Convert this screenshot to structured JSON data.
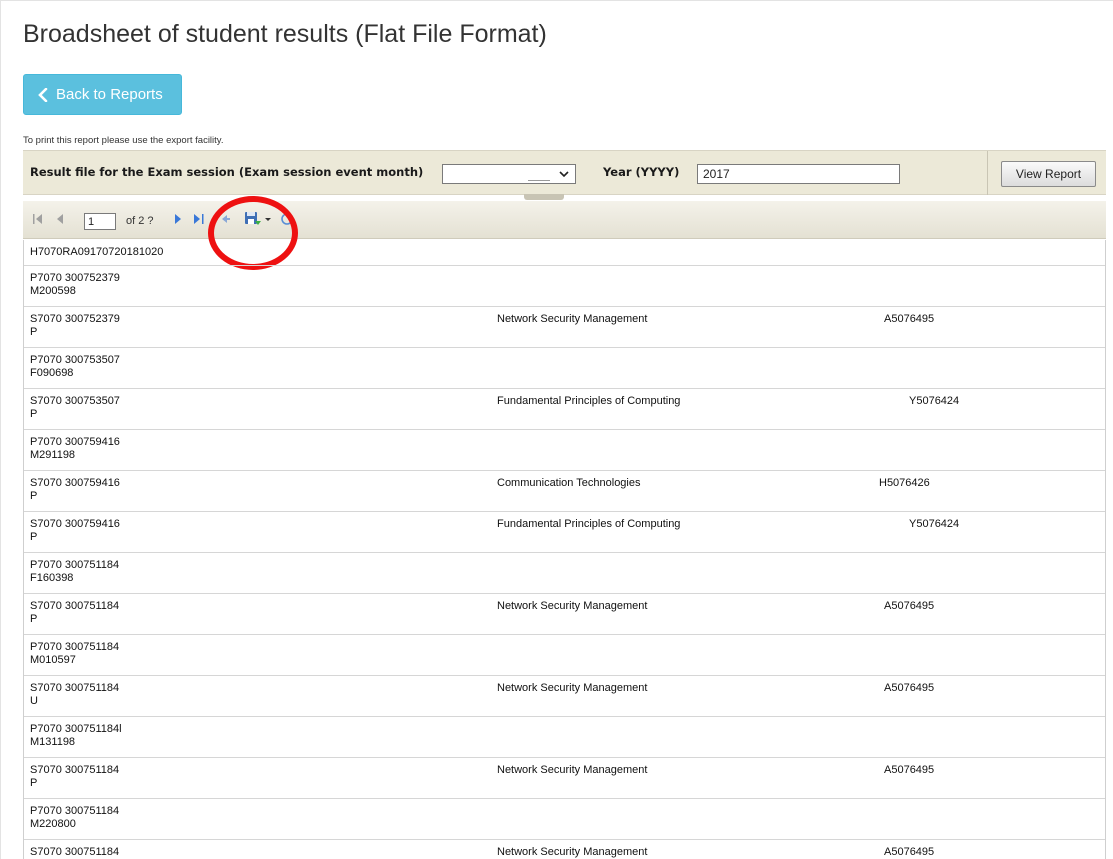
{
  "page": {
    "title": "Broadsheet of student results (Flat File Format)",
    "back_button": "Back to Reports",
    "print_note": "To print this report please use the export facility."
  },
  "params": {
    "month_label": "Result file for the Exam session (Exam session event month)",
    "month_value": "",
    "year_label": "Year (YYYY)",
    "year_value": "2017",
    "view_report": "View Report"
  },
  "toolbar": {
    "current_page": "1",
    "page_of": "of 2 ?",
    "icons": [
      "first-page-icon",
      "previous-page-icon",
      "next-page-icon",
      "last-page-icon",
      "back-icon",
      "save-export-icon",
      "refresh-icon"
    ]
  },
  "colors": {
    "accent": "#5bc0de",
    "param_bar": "#ece9d8",
    "highlight": "#ee1111"
  },
  "rows": [
    {
      "line1": "H7070RA09170720181020",
      "line2": "",
      "subject": "",
      "code": ""
    },
    {
      "line1": "P7070  300752379",
      "line2": "M200598",
      "subject": "",
      "code": ""
    },
    {
      "line1": "S7070  300752379",
      "line2": "P",
      "subject": "Network Security Management",
      "code": "A5076495"
    },
    {
      "line1": "P7070  300753507",
      "line2": "F090698",
      "subject": "",
      "code": ""
    },
    {
      "line1": "S7070  300753507",
      "line2": "P",
      "subject": "Fundamental Principles of Computing",
      "code": "Y5076424"
    },
    {
      "line1": "P7070  300759416",
      "line2": "M291198",
      "subject": "",
      "code": ""
    },
    {
      "line1": "S7070  300759416",
      "line2": "P",
      "subject": "Communication Technologies",
      "code": "H5076426"
    },
    {
      "line1": "S7070  300759416",
      "line2": "P",
      "subject": "Fundamental Principles of Computing",
      "code": "Y5076424"
    },
    {
      "line1": "P7070  300751184",
      "line2": "F160398",
      "subject": "",
      "code": ""
    },
    {
      "line1": "S7070  300751184",
      "line2": "P",
      "subject": "Network Security Management",
      "code": "A5076495"
    },
    {
      "line1": "P7070  300751184",
      "line2": "M010597",
      "subject": "",
      "code": ""
    },
    {
      "line1": "S7070  300751184",
      "line2": "U",
      "subject": "Network Security Management",
      "code": "A5076495"
    },
    {
      "line1": "P7070  300751184l",
      "line2": "M131198",
      "subject": "",
      "code": ""
    },
    {
      "line1": "S7070  300751184",
      "line2": "P",
      "subject": "Network Security Management",
      "code": "A5076495"
    },
    {
      "line1": "P7070  300751184",
      "line2": "M220800",
      "subject": "",
      "code": ""
    },
    {
      "line1": "S7070  300751184",
      "line2": "",
      "subject": "Network Security Management",
      "code": "A5076495"
    }
  ]
}
